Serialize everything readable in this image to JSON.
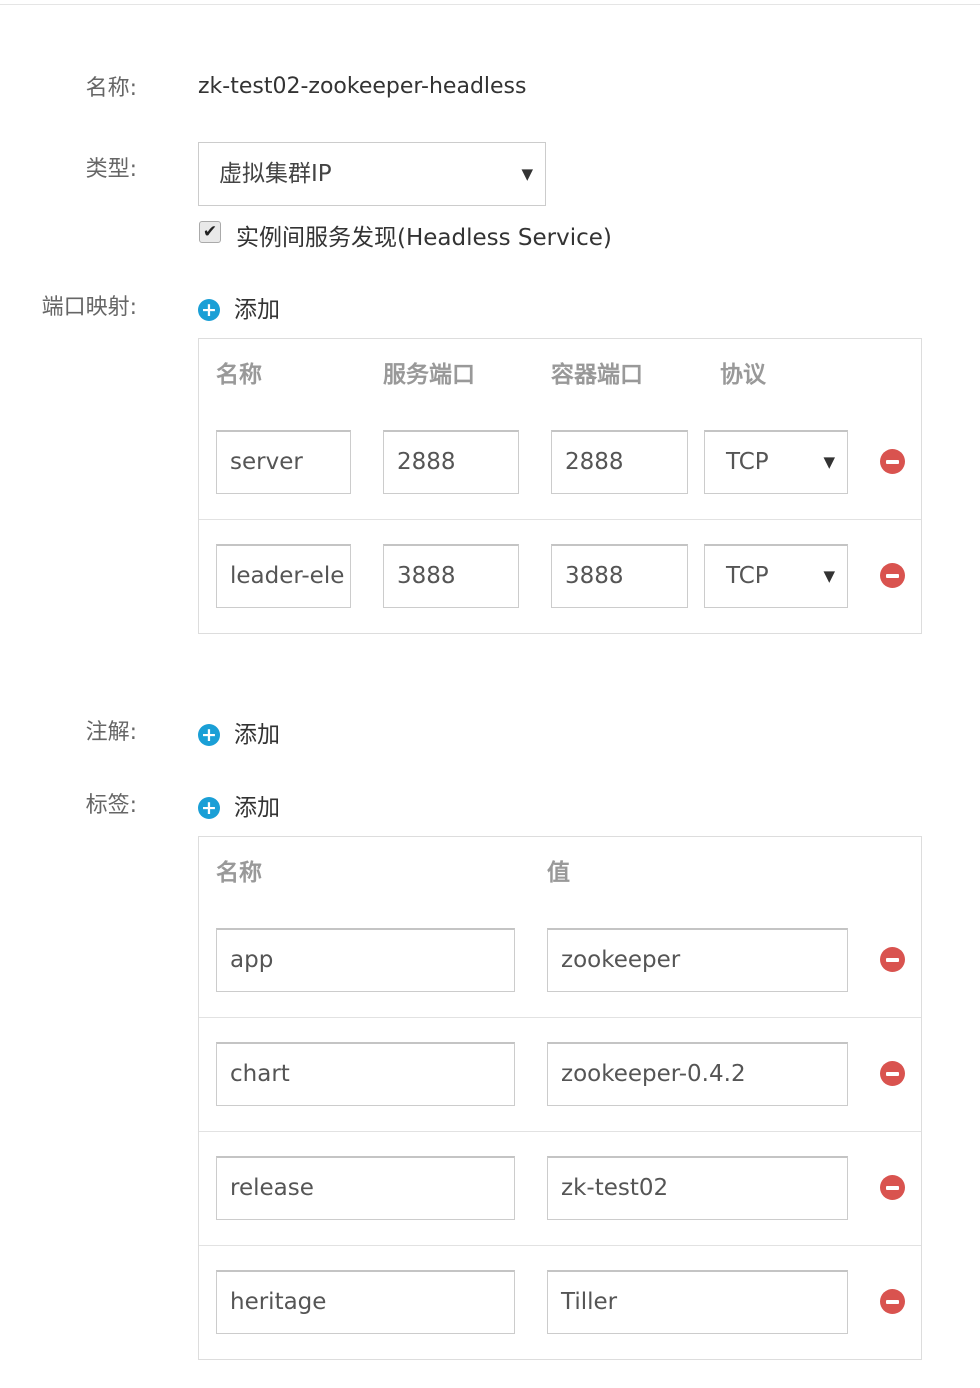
{
  "form": {
    "name_label": "名称:",
    "name_value": "zk-test02-zookeeper-headless",
    "type_label": "类型:",
    "type_value": "虚拟集群IP",
    "headless_checked": true,
    "headless_label": "实例间服务发现(Headless Service)",
    "ports_label": "端口映射:",
    "annotations_label": "注解:",
    "labels_label": "标签:"
  },
  "add_label": "添加",
  "ports": {
    "headers": {
      "name": "名称",
      "service_port": "服务端口",
      "container_port": "容器端口",
      "protocol": "协议"
    },
    "rows": [
      {
        "name": "server",
        "service_port": "2888",
        "container_port": "2888",
        "protocol": "TCP"
      },
      {
        "name": "leader-ele",
        "service_port": "3888",
        "container_port": "3888",
        "protocol": "TCP"
      }
    ]
  },
  "labels": {
    "headers": {
      "name": "名称",
      "value": "值"
    },
    "rows": [
      {
        "name": "app",
        "value": "zookeeper"
      },
      {
        "name": "chart",
        "value": "zookeeper-0.4.2"
      },
      {
        "name": "release",
        "value": "zk-test02"
      },
      {
        "name": "heritage",
        "value": "Tiller"
      }
    ]
  },
  "icons": {
    "add": "plus-circle-icon",
    "remove": "minus-circle-icon",
    "dropdown": "triangle-down-icon",
    "check": "check-icon"
  },
  "colors": {
    "accent": "#1a9fd6",
    "danger": "#d9534f",
    "label": "#666666",
    "header": "#999999",
    "border": "#dddddd"
  }
}
